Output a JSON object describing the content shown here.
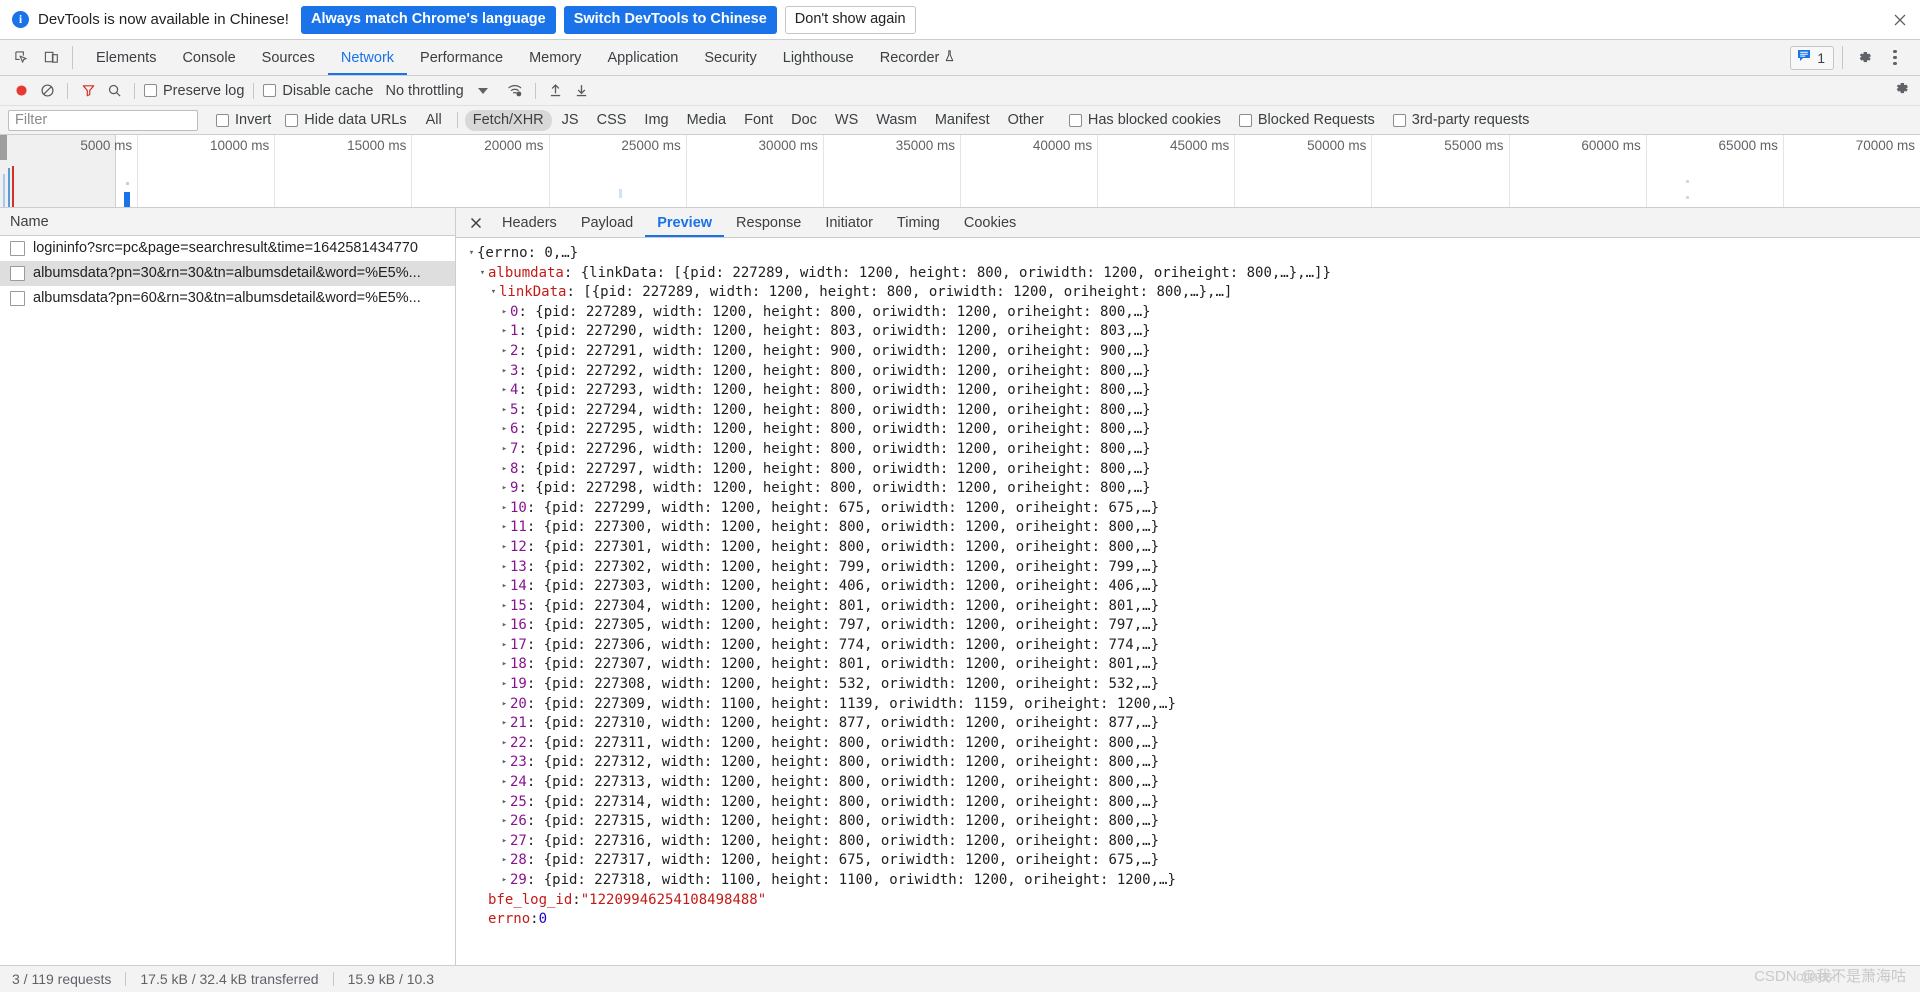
{
  "infobar": {
    "icon": "info-icon",
    "message": "DevTools is now available in Chinese!",
    "primary_button": "Always match Chrome's language",
    "secondary_button": "Switch DevTools to Chinese",
    "dismiss_button": "Don't show again",
    "close_icon": "close-icon",
    "primary_color": "#1a73e8"
  },
  "main_tabs": {
    "inspect_icon": "inspect-element-icon",
    "device_icon": "device-toolbar-icon",
    "items": [
      {
        "label": "Elements",
        "active": false
      },
      {
        "label": "Console",
        "active": false
      },
      {
        "label": "Sources",
        "active": false
      },
      {
        "label": "Network",
        "active": true
      },
      {
        "label": "Performance",
        "active": false
      },
      {
        "label": "Memory",
        "active": false
      },
      {
        "label": "Application",
        "active": false
      },
      {
        "label": "Security",
        "active": false
      },
      {
        "label": "Lighthouse",
        "active": false
      },
      {
        "label": "Recorder",
        "active": false
      }
    ],
    "recorder_badge_icon": "experiment-flask-icon",
    "issues_count": "1",
    "issues_icon": "issues-message-icon",
    "settings_icon": "gear-icon",
    "more_icon": "more-vertical-icon"
  },
  "network_toolbar": {
    "record_icon": "record-circle-icon",
    "clear_icon": "clear-no-entry-icon",
    "filter_icon": "funnel-filter-icon",
    "search_icon": "search-icon",
    "preserve_log": "Preserve log",
    "disable_cache": "Disable cache",
    "throttling": "No throttling",
    "throttling_caret": "chevron-down-icon",
    "wifi_icon": "network-conditions-wifi-icon",
    "import_icon": "import-har-up-arrow-icon",
    "export_icon": "export-har-down-arrow-icon",
    "settings_icon": "gear-icon"
  },
  "filter_row": {
    "placeholder": "Filter",
    "value": "",
    "invert": "Invert",
    "hide_data_urls": "Hide data URLs",
    "types": [
      {
        "label": "All",
        "active": false
      },
      {
        "label": "Fetch/XHR",
        "active": true
      },
      {
        "label": "JS",
        "active": false
      },
      {
        "label": "CSS",
        "active": false
      },
      {
        "label": "Img",
        "active": false
      },
      {
        "label": "Media",
        "active": false
      },
      {
        "label": "Font",
        "active": false
      },
      {
        "label": "Doc",
        "active": false
      },
      {
        "label": "WS",
        "active": false
      },
      {
        "label": "Wasm",
        "active": false
      },
      {
        "label": "Manifest",
        "active": false
      },
      {
        "label": "Other",
        "active": false
      }
    ],
    "has_blocked_cookies": "Has blocked cookies",
    "blocked_requests": "Blocked Requests",
    "third_party_requests": "3rd-party requests"
  },
  "overview": {
    "ticks": [
      "5000 ms",
      "10000 ms",
      "15000 ms",
      "20000 ms",
      "25000 ms",
      "30000 ms",
      "35000 ms",
      "40000 ms",
      "45000 ms",
      "50000 ms",
      "55000 ms",
      "60000 ms",
      "65000 ms",
      "70000 ms"
    ]
  },
  "request_panel": {
    "column_header": "Name",
    "rows": [
      {
        "name": "logininfo?src=pc&page=searchresult&time=1642581434770",
        "selected": false
      },
      {
        "name": "albumsdata?pn=30&rn=30&tn=albumsdetail&word=%E5%...",
        "selected": true
      },
      {
        "name": "albumsdata?pn=60&rn=30&tn=albumsdetail&word=%E5%...",
        "selected": false
      }
    ]
  },
  "detail_panel": {
    "close_icon": "close-icon",
    "tabs": [
      {
        "label": "Headers",
        "active": false
      },
      {
        "label": "Payload",
        "active": false
      },
      {
        "label": "Preview",
        "active": true
      },
      {
        "label": "Response",
        "active": false
      },
      {
        "label": "Initiator",
        "active": false
      },
      {
        "label": "Timing",
        "active": false
      },
      {
        "label": "Cookies",
        "active": false
      }
    ]
  },
  "preview": {
    "root_line": "{errno: 0,…}",
    "albumdata_key": "albumdata",
    "albumdata_value": ": {linkData: [{pid: 227289, width: 1200, height: 800, oriwidth: 1200, oriheight: 800,…},…]}",
    "linkdata_key": "linkData",
    "linkdata_value": ": [{pid: 227289, width: 1200, height: 800, oriwidth: 1200, oriheight: 800,…},…]",
    "items": [
      {
        "index": "0",
        "pid": "227289",
        "width": "1200",
        "height": "800",
        "oriwidth": "1200",
        "oriheight": "800"
      },
      {
        "index": "1",
        "pid": "227290",
        "width": "1200",
        "height": "803",
        "oriwidth": "1200",
        "oriheight": "803"
      },
      {
        "index": "2",
        "pid": "227291",
        "width": "1200",
        "height": "900",
        "oriwidth": "1200",
        "oriheight": "900"
      },
      {
        "index": "3",
        "pid": "227292",
        "width": "1200",
        "height": "800",
        "oriwidth": "1200",
        "oriheight": "800"
      },
      {
        "index": "4",
        "pid": "227293",
        "width": "1200",
        "height": "800",
        "oriwidth": "1200",
        "oriheight": "800"
      },
      {
        "index": "5",
        "pid": "227294",
        "width": "1200",
        "height": "800",
        "oriwidth": "1200",
        "oriheight": "800"
      },
      {
        "index": "6",
        "pid": "227295",
        "width": "1200",
        "height": "800",
        "oriwidth": "1200",
        "oriheight": "800"
      },
      {
        "index": "7",
        "pid": "227296",
        "width": "1200",
        "height": "800",
        "oriwidth": "1200",
        "oriheight": "800"
      },
      {
        "index": "8",
        "pid": "227297",
        "width": "1200",
        "height": "800",
        "oriwidth": "1200",
        "oriheight": "800"
      },
      {
        "index": "9",
        "pid": "227298",
        "width": "1200",
        "height": "800",
        "oriwidth": "1200",
        "oriheight": "800"
      },
      {
        "index": "10",
        "pid": "227299",
        "width": "1200",
        "height": "675",
        "oriwidth": "1200",
        "oriheight": "675"
      },
      {
        "index": "11",
        "pid": "227300",
        "width": "1200",
        "height": "800",
        "oriwidth": "1200",
        "oriheight": "800"
      },
      {
        "index": "12",
        "pid": "227301",
        "width": "1200",
        "height": "800",
        "oriwidth": "1200",
        "oriheight": "800"
      },
      {
        "index": "13",
        "pid": "227302",
        "width": "1200",
        "height": "799",
        "oriwidth": "1200",
        "oriheight": "799"
      },
      {
        "index": "14",
        "pid": "227303",
        "width": "1200",
        "height": "406",
        "oriwidth": "1200",
        "oriheight": "406"
      },
      {
        "index": "15",
        "pid": "227304",
        "width": "1200",
        "height": "801",
        "oriwidth": "1200",
        "oriheight": "801"
      },
      {
        "index": "16",
        "pid": "227305",
        "width": "1200",
        "height": "797",
        "oriwidth": "1200",
        "oriheight": "797"
      },
      {
        "index": "17",
        "pid": "227306",
        "width": "1200",
        "height": "774",
        "oriwidth": "1200",
        "oriheight": "774"
      },
      {
        "index": "18",
        "pid": "227307",
        "width": "1200",
        "height": "801",
        "oriwidth": "1200",
        "oriheight": "801"
      },
      {
        "index": "19",
        "pid": "227308",
        "width": "1200",
        "height": "532",
        "oriwidth": "1200",
        "oriheight": "532"
      },
      {
        "index": "20",
        "pid": "227309",
        "width": "1100",
        "height": "1139",
        "oriwidth": "1159",
        "oriheight": "1200"
      },
      {
        "index": "21",
        "pid": "227310",
        "width": "1200",
        "height": "877",
        "oriwidth": "1200",
        "oriheight": "877"
      },
      {
        "index": "22",
        "pid": "227311",
        "width": "1200",
        "height": "800",
        "oriwidth": "1200",
        "oriheight": "800"
      },
      {
        "index": "23",
        "pid": "227312",
        "width": "1200",
        "height": "800",
        "oriwidth": "1200",
        "oriheight": "800"
      },
      {
        "index": "24",
        "pid": "227313",
        "width": "1200",
        "height": "800",
        "oriwidth": "1200",
        "oriheight": "800"
      },
      {
        "index": "25",
        "pid": "227314",
        "width": "1200",
        "height": "800",
        "oriwidth": "1200",
        "oriheight": "800"
      },
      {
        "index": "26",
        "pid": "227315",
        "width": "1200",
        "height": "800",
        "oriwidth": "1200",
        "oriheight": "800"
      },
      {
        "index": "27",
        "pid": "227316",
        "width": "1200",
        "height": "800",
        "oriwidth": "1200",
        "oriheight": "800"
      },
      {
        "index": "28",
        "pid": "227317",
        "width": "1200",
        "height": "675",
        "oriwidth": "1200",
        "oriheight": "675"
      },
      {
        "index": "29",
        "pid": "227318",
        "width": "1100",
        "height": "1100",
        "oriwidth": "1200",
        "oriheight": "1200"
      }
    ],
    "bfe_log_id_key": "bfe_log_id",
    "bfe_log_id_value": "\"12209946254108498488\"",
    "errno_key": "errno",
    "errno_value": "0"
  },
  "status_bar": {
    "requests": "3 / 119 requests",
    "transferred": "17.5 kB / 32.4 kB transferred",
    "resources": "15.9 kB / 10.3"
  },
  "watermark": {
    "line1": "CSDN @我不是萧海咕",
    "line2": "ctiaosi"
  }
}
